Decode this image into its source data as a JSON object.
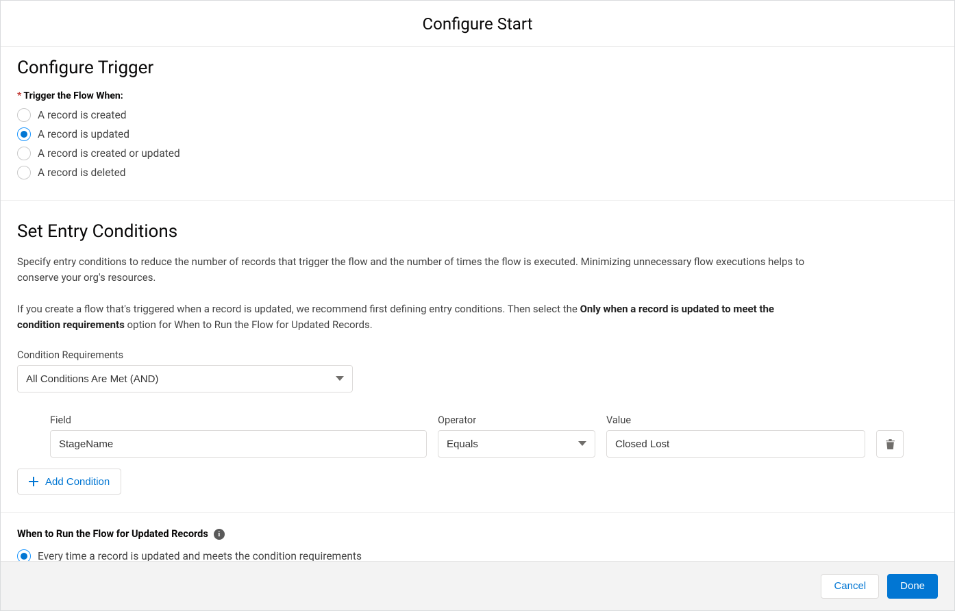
{
  "dialog": {
    "title": "Configure Start"
  },
  "trigger": {
    "section_title": "Configure Trigger",
    "label": "Trigger the Flow When:",
    "options": [
      {
        "label": "A record is created",
        "selected": false
      },
      {
        "label": "A record is updated",
        "selected": true
      },
      {
        "label": "A record is created or updated",
        "selected": false
      },
      {
        "label": "A record is deleted",
        "selected": false
      }
    ]
  },
  "entry": {
    "section_title": "Set Entry Conditions",
    "para1": "Specify entry conditions to reduce the number of records that trigger the flow and the number of times the flow is executed. Minimizing unnecessary flow executions helps to conserve your org's resources.",
    "para2_pre": "If you create a flow that's triggered when a record is updated, we recommend first defining entry conditions. Then select the ",
    "para2_bold": "Only when a record is updated to meet the condition requirements",
    "para2_post": " option for When to Run the Flow for Updated Records.",
    "cond_req_label": "Condition Requirements",
    "cond_req_value": "All Conditions Are Met (AND)",
    "columns": {
      "field": "Field",
      "operator": "Operator",
      "value": "Value"
    },
    "row": {
      "field": "StageName",
      "operator": "Equals",
      "value": "Closed Lost"
    },
    "add_condition": "Add Condition"
  },
  "when_run": {
    "label": "When to Run the Flow for Updated Records",
    "options": [
      {
        "label": "Every time a record is updated and meets the condition requirements",
        "selected": true
      }
    ]
  },
  "footer": {
    "cancel": "Cancel",
    "done": "Done"
  }
}
